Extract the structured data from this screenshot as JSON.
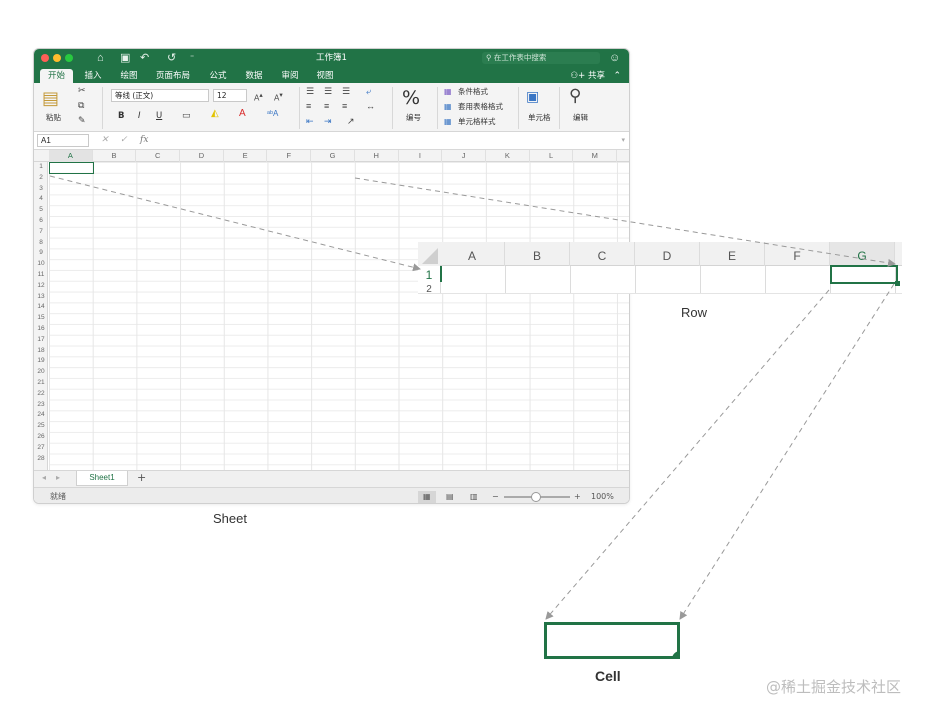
{
  "window": {
    "title": "工作簿1",
    "search_placeholder": "在工作表中搜索",
    "tabs": [
      "开始",
      "插入",
      "绘图",
      "页面布局",
      "公式",
      "数据",
      "审阅",
      "视图"
    ],
    "share_label": "共享"
  },
  "ribbon": {
    "paste": "粘贴",
    "font_name": "等线 (正文)",
    "font_size": "12",
    "bold": "B",
    "italic": "I",
    "underline": "U",
    "number_label": "编号",
    "percent_symbol": "%",
    "conditional_format": "条件格式",
    "table_format": "套用表格格式",
    "cell_style": "单元格样式",
    "cells_label": "单元格",
    "edit_label": "编辑"
  },
  "formula_bar": {
    "name_box": "A1",
    "fx": "fx"
  },
  "grid": {
    "columns": [
      "A",
      "B",
      "C",
      "D",
      "E",
      "F",
      "G",
      "H",
      "I",
      "J",
      "K",
      "L",
      "M"
    ],
    "rows": [
      "1",
      "2",
      "3",
      "4",
      "5",
      "6",
      "7",
      "8",
      "9",
      "10",
      "11",
      "12",
      "13",
      "14",
      "15",
      "16",
      "17",
      "18",
      "19",
      "20",
      "21",
      "22",
      "23",
      "24",
      "25",
      "26",
      "27",
      "28"
    ]
  },
  "sheet_tab": "Sheet1",
  "add_sheet": "+",
  "status": {
    "ready": "就绪",
    "zoom": "100%"
  },
  "zoomed_row": {
    "columns": [
      "A",
      "B",
      "C",
      "D",
      "E",
      "F",
      "G"
    ],
    "rows": [
      "1",
      "2"
    ]
  },
  "labels": {
    "sheet": "Sheet",
    "row": "Row",
    "cell": "Cell"
  },
  "watermark": "@稀土掘金技术社区",
  "colors": {
    "excel_green": "#217346",
    "arrow": "#999999"
  }
}
